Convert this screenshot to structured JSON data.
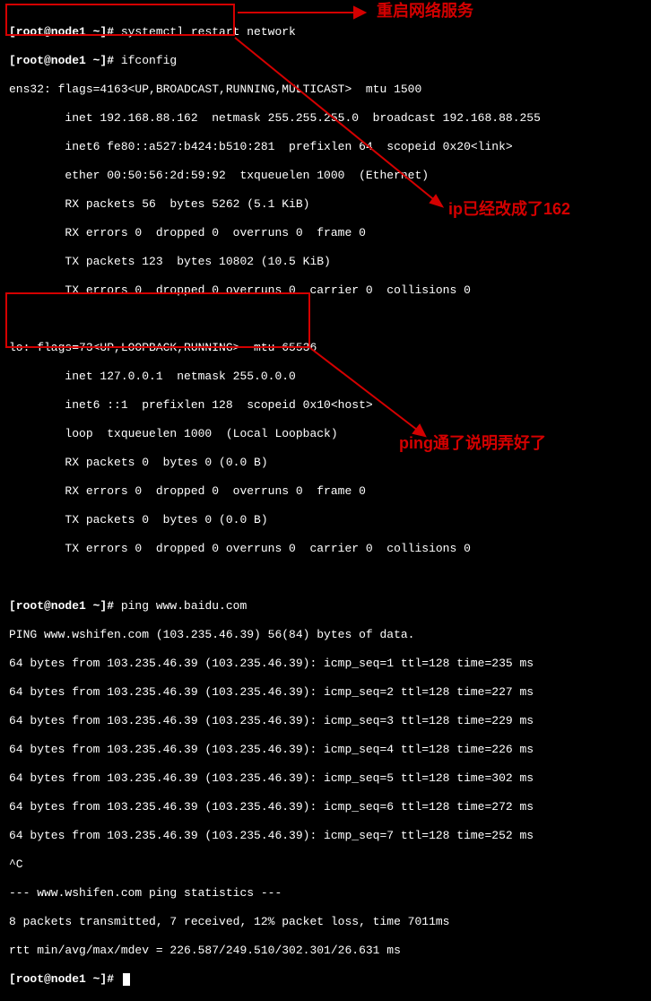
{
  "prompt": "[root@node1 ~]# ",
  "cmds": {
    "restart": "systemctl restart network",
    "ifconfig": "ifconfig",
    "ping": "ping www.baidu.com"
  },
  "ifconfig": {
    "ens32_header": "ens32: flags=4163<UP,BROADCAST,RUNNING,MULTICAST>  mtu 1500",
    "ens32_inet": "        inet 192.168.88.162  netmask 255.255.255.0  broadcast 192.168.88.255",
    "ens32_inet6": "        inet6 fe80::a527:b424:b510:281  prefixlen 64  scopeid 0x20<link>",
    "ens32_ether": "        ether 00:50:56:2d:59:92  txqueuelen 1000  (Ethernet)",
    "ens32_rxp": "        RX packets 56  bytes 5262 (5.1 KiB)",
    "ens32_rxe": "        RX errors 0  dropped 0  overruns 0  frame 0",
    "ens32_txp": "        TX packets 123  bytes 10802 (10.5 KiB)",
    "ens32_txe": "        TX errors 0  dropped 0 overruns 0  carrier 0  collisions 0",
    "lo_header": "lo: flags=73<UP,LOOPBACK,RUNNING>  mtu 65536",
    "lo_inet": "        inet 127.0.0.1  netmask 255.0.0.0",
    "lo_inet6": "        inet6 ::1  prefixlen 128  scopeid 0x10<host>",
    "lo_loop": "        loop  txqueuelen 1000  (Local Loopback)",
    "lo_rxp": "        RX packets 0  bytes 0 (0.0 B)",
    "lo_rxe": "        RX errors 0  dropped 0  overruns 0  frame 0",
    "lo_txp": "        TX packets 0  bytes 0 (0.0 B)",
    "lo_txe": "        TX errors 0  dropped 0 overruns 0  carrier 0  collisions 0"
  },
  "ping": {
    "header": "PING www.wshifen.com (103.235.46.39) 56(84) bytes of data.",
    "lines": [
      "64 bytes from 103.235.46.39 (103.235.46.39): icmp_seq=1 ttl=128 time=235 ms",
      "64 bytes from 103.235.46.39 (103.235.46.39): icmp_seq=2 ttl=128 time=227 ms",
      "64 bytes from 103.235.46.39 (103.235.46.39): icmp_seq=3 ttl=128 time=229 ms",
      "64 bytes from 103.235.46.39 (103.235.46.39): icmp_seq=4 ttl=128 time=226 ms",
      "64 bytes from 103.235.46.39 (103.235.46.39): icmp_seq=5 ttl=128 time=302 ms",
      "64 bytes from 103.235.46.39 (103.235.46.39): icmp_seq=6 ttl=128 time=272 ms",
      "64 bytes from 103.235.46.39 (103.235.46.39): icmp_seq=7 ttl=128 time=252 ms"
    ],
    "ctrlc": "^C",
    "stats_hdr": "--- www.wshifen.com ping statistics ---",
    "stats1": "8 packets transmitted, 7 received, 12% packet loss, time 7011ms",
    "stats2": "rtt min/avg/max/mdev = 226.587/249.510/302.301/26.631 ms"
  },
  "annotations": {
    "restart_label": "重启网络服务",
    "ip_label": "ip已经改成了162",
    "ping_label": "ping通了说明弄好了"
  },
  "colors": {
    "accent": "#d40000"
  }
}
